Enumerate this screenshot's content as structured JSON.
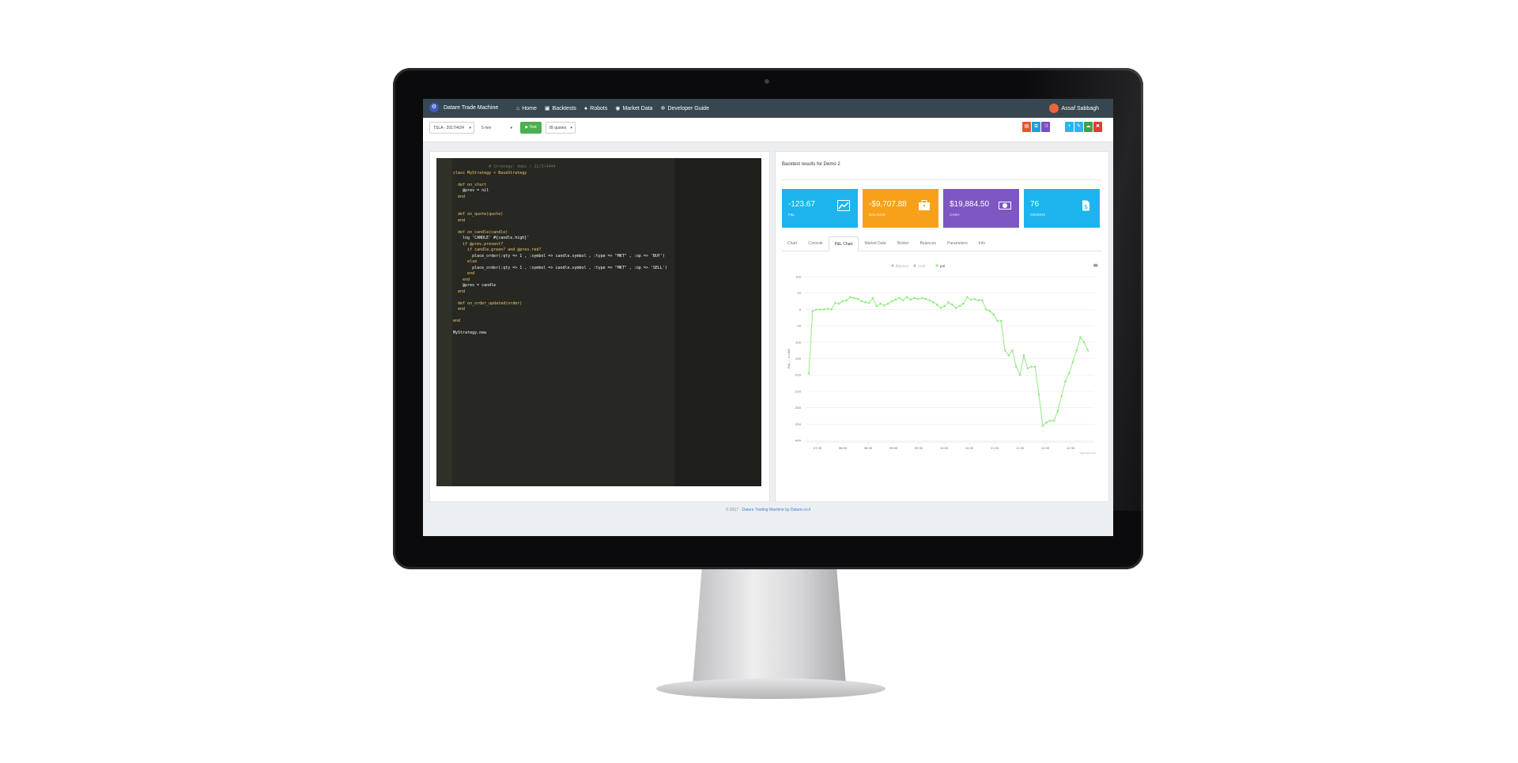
{
  "navbar": {
    "brand": "Datare Trade Machine",
    "links": [
      {
        "icon": "home-icon",
        "label": "Home"
      },
      {
        "icon": "backtests-icon",
        "label": "Backtests"
      },
      {
        "icon": "robot-icon",
        "label": "Robots"
      },
      {
        "icon": "globe-icon",
        "label": "Market Data"
      },
      {
        "icon": "gear-icon",
        "label": "Developer Guide"
      }
    ],
    "user": "Assaf Sabbagh"
  },
  "toolbar": {
    "symbol_select": "TSLA - 2017/4/24",
    "interval_select": "5 min",
    "test_label": "Test",
    "quotes_select": "IB quotes",
    "buttons_left": [
      {
        "icon": "save-icon",
        "color": "#e8542e"
      },
      {
        "icon": "copy-icon",
        "color": "#1da1dc"
      },
      {
        "icon": "shuffle-icon",
        "color": "#7c4dbe"
      }
    ],
    "buttons_right": [
      {
        "icon": "plus-icon",
        "color": "#2bb5f0"
      },
      {
        "icon": "edit-icon",
        "color": "#2bb5f0"
      },
      {
        "icon": "cloud-icon",
        "color": "#43a047"
      },
      {
        "icon": "trash-icon",
        "color": "#e53935"
      }
    ]
  },
  "editor": {
    "lines": [
      "               # Strategy: demo | 22/3/4444",
      "class MyStrategy < BaseStrategy",
      "",
      "  def on_start",
      "    @prev = nil",
      "  end",
      "",
      "",
      "  def on_quote(quote)",
      "  end",
      "",
      "  def on_candle(candle)",
      "    log 'CANDLE' #{candle.high}'",
      "    if @prev.present?",
      "      if candle.green? and @prev.red?",
      "        place_order(:qty => 1 , :symbol => candle.symbol , :type => \"MKT\" , :op => 'BUY')",
      "      else",
      "        place_order(:qty => 1 , :symbol => candle.symbol , :type => \"MKT\" , :op => 'SELL')",
      "      end",
      "    end",
      "    @prev = candle",
      "  end",
      "",
      "  def on_order_updated(order)",
      "  end",
      "",
      "end",
      "",
      "MyStrategy.new"
    ]
  },
  "results": {
    "title": "Backtest results for Demo 2",
    "kpis": [
      {
        "value": "-123.67",
        "label": "P&L",
        "color": "#1eb4ee",
        "icon": "chart-trend-icon"
      },
      {
        "value": "-$9,707.88",
        "label": "BALANCE",
        "color": "#f7a11a",
        "icon": "briefcase-icon"
      },
      {
        "value": "$19,884.50",
        "label": "CASH",
        "color": "#7e57c2",
        "icon": "banknote-icon"
      },
      {
        "value": "76",
        "label": "ORDERS",
        "color": "#1eb4ee",
        "icon": "document-dollar-icon"
      }
    ],
    "tabs": [
      "Chart",
      "Console",
      "P&L Chart",
      "Market Data",
      "Broker",
      "Balances",
      "Parameters",
      "Info"
    ],
    "active_tab": "P&L Chart"
  },
  "chart_data": {
    "type": "line",
    "legend": [
      "Balance",
      "cash",
      "pnl"
    ],
    "legend_position": "top-center",
    "ylabel": "P&L — in USD",
    "y_ticks": [
      "100",
      "50",
      "0",
      "-50",
      "-100",
      "-150",
      "-200",
      "-250",
      "-300",
      "-350",
      "-400"
    ],
    "x_ticks": [
      "07:30",
      "08:00",
      "08:30",
      "09:00",
      "09:30",
      "10:00",
      "10:30",
      "11:00",
      "11:30",
      "12:00",
      "12:30"
    ],
    "ylim": [
      -400,
      100
    ],
    "series": [
      {
        "name": "pnl",
        "color": "#90ee7e",
        "values": [
          -195,
          -5,
          0,
          0,
          0,
          2,
          0,
          20,
          18,
          25,
          28,
          38,
          35,
          32,
          25,
          22,
          20,
          35,
          10,
          18,
          12,
          18,
          25,
          30,
          35,
          28,
          38,
          30,
          35,
          32,
          35,
          32,
          28,
          22,
          15,
          5,
          10,
          22,
          15,
          5,
          10,
          18,
          38,
          30,
          32,
          28,
          28,
          0,
          -5,
          -15,
          -35,
          -35,
          -125,
          -140,
          -125,
          -175,
          -200,
          -140,
          -180,
          -175,
          -175,
          -260,
          -355,
          -345,
          -340,
          -340,
          -310,
          -265,
          -220,
          -195,
          -160,
          -125,
          -85,
          -100,
          -125
        ]
      }
    ],
    "grid": true,
    "credits": "Highcharts.com"
  },
  "footer": {
    "prefix": "© 2017 ·",
    "link": "Datare Trading Machine by Datare.co.il"
  }
}
